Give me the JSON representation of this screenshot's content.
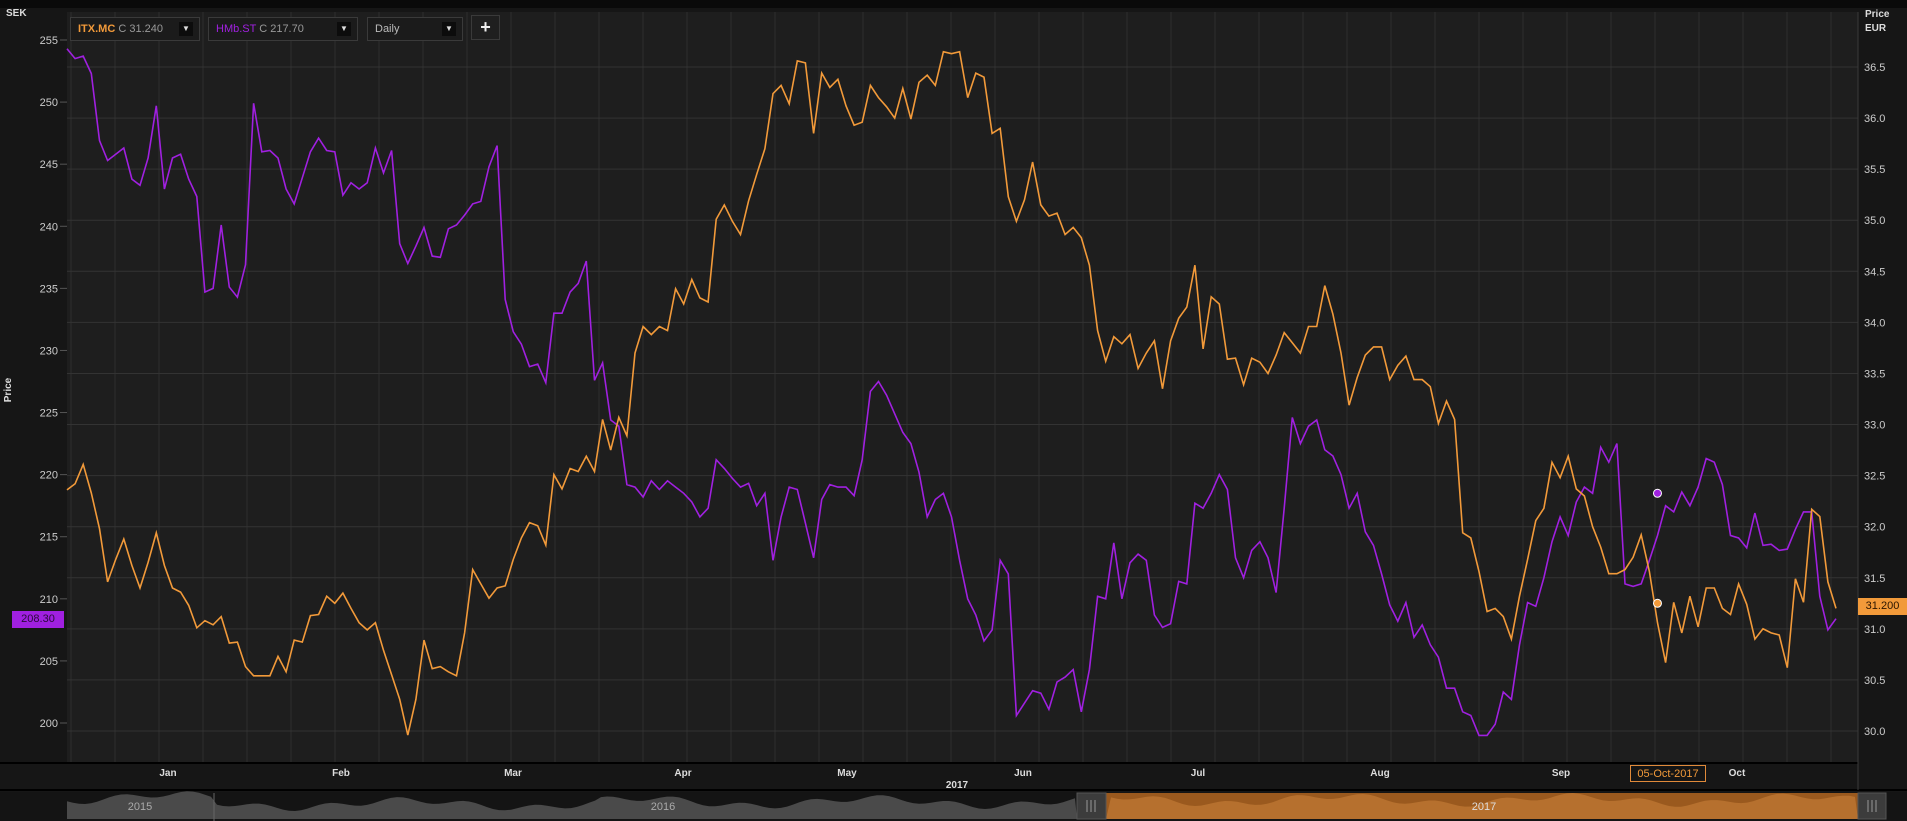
{
  "toolbar": {
    "series1_symbol": "ITX.MC",
    "series1_close": "C 31.240",
    "series2_symbol": "HMb.ST",
    "series2_close": "C 217.70",
    "interval": "Daily",
    "add_label": "+"
  },
  "axes": {
    "left_unit": "SEK",
    "left_title": "Price",
    "right_title": "Price",
    "right_unit": "EUR"
  },
  "last_values": {
    "left": "208.30",
    "right": "31.200"
  },
  "crosshair_date": "05-Oct-2017",
  "navigator": {
    "years": [
      "2015",
      "2016",
      "2017"
    ]
  },
  "colors": {
    "itx": "#f29a3a",
    "hm": "#a020e0",
    "bg": "#1e1e1e",
    "grid": "#333333"
  },
  "chart_data": {
    "type": "line",
    "title": "",
    "xlabel": "2017",
    "x_tick_labels": [
      "Jan",
      "Feb",
      "Mar",
      "Apr",
      "May",
      "Jun",
      "Jul",
      "Aug",
      "Sep",
      "Oct"
    ],
    "left_axis": {
      "label": "Price",
      "unit": "SEK",
      "ylim": [
        199,
        256
      ],
      "ticks": [
        200,
        205,
        210,
        215,
        220,
        225,
        230,
        235,
        240,
        245,
        250,
        255
      ]
    },
    "right_axis": {
      "label": "Price",
      "unit": "EUR",
      "ylim": [
        29.85,
        36.65
      ],
      "ticks": [
        30.0,
        30.5,
        31.0,
        31.5,
        32.0,
        32.5,
        33.0,
        33.5,
        34.0,
        34.5,
        35.0,
        35.5,
        36.0,
        36.5
      ]
    },
    "hover": {
      "date": "05-Oct-2017",
      "index": 196,
      "hm": 218.5,
      "itx": 31.25
    },
    "series": [
      {
        "name": "HMb.ST",
        "axis": "left",
        "color": "#a020e0",
        "values": [
          254.3,
          253.5,
          253.7,
          252.3,
          246.9,
          245.3,
          245.8,
          246.3,
          243.8,
          243.3,
          245.5,
          249.7,
          243,
          245.5,
          245.8,
          243.8,
          242.4,
          234.7,
          235,
          240.1,
          235.1,
          234.3,
          236.9,
          249.9,
          246,
          246.1,
          245.5,
          243,
          241.8,
          243.9,
          246,
          247.1,
          246.1,
          246,
          242.5,
          243.5,
          243,
          243.5,
          246.3,
          244.3,
          246.1,
          238.6,
          237,
          238.4,
          239.9,
          237.6,
          237.5,
          239.8,
          240.1,
          240.9,
          241.8,
          242,
          244.8,
          246.5,
          234.1,
          231.5,
          230.5,
          228.7,
          228.9,
          227.4,
          233,
          233,
          234.7,
          235.4,
          237.2,
          227.6,
          229,
          224.4,
          223.9,
          219.2,
          219,
          218.2,
          219.5,
          218.8,
          219.5,
          219,
          218.5,
          217.8,
          216.6,
          217.3,
          221.2,
          220.5,
          219.7,
          219,
          219.3,
          217.5,
          218.5,
          213.1,
          216.6,
          219,
          218.8,
          216.1,
          213.3,
          218,
          219.2,
          219,
          219,
          218.3,
          221.2,
          226.7,
          227.5,
          226.4,
          224.9,
          223.4,
          222.5,
          220.2,
          216.6,
          218,
          218.5,
          216.6,
          213.1,
          210,
          208.7,
          206.6,
          207.5,
          213.1,
          212,
          200.6,
          201.6,
          202.6,
          202.4,
          201.1,
          203.3,
          203.7,
          204.3,
          200.9,
          204.3,
          210.2,
          210,
          214.5,
          210,
          212.9,
          213.6,
          213.1,
          208.7,
          207.7,
          208,
          211.4,
          211.2,
          217.7,
          217.3,
          218.5,
          220,
          218.8,
          213.3,
          211.7,
          213.9,
          214.6,
          213.3,
          210.5,
          217.3,
          224.6,
          222.5,
          223.9,
          224.4,
          222,
          221.5,
          220,
          217.3,
          218.5,
          215.4,
          214.3,
          212,
          209.5,
          208.2,
          209.7,
          206.9,
          207.9,
          206.3,
          205.3,
          202.8,
          202.8,
          200.9,
          200.6,
          199,
          199,
          199.9,
          202.5,
          201.9,
          206.3,
          209.7,
          209.4,
          211.7,
          214.6,
          216.6,
          215.1,
          217.8,
          219,
          218.5,
          222.2,
          221,
          222.5,
          211.2,
          211,
          211.2,
          213.1,
          215.1,
          217.5,
          217,
          218.6,
          217.5,
          219,
          221.3,
          221,
          219.2,
          215.1,
          214.9,
          214.1,
          216.9,
          214.3,
          214.4,
          213.9,
          214,
          215.6,
          217,
          217,
          210.2,
          207.5,
          208.4
        ]
      },
      {
        "name": "ITX.MC",
        "axis": "right",
        "color": "#f29a3a",
        "values": [
          32.36,
          32.42,
          32.61,
          32.33,
          31.98,
          31.46,
          31.68,
          31.88,
          31.62,
          31.4,
          31.65,
          31.94,
          31.62,
          31.4,
          31.36,
          31.23,
          31.01,
          31.08,
          31.04,
          31.12,
          30.86,
          30.87,
          30.63,
          30.54,
          30.54,
          30.54,
          30.73,
          30.58,
          30.89,
          30.87,
          31.13,
          31.14,
          31.32,
          31.25,
          31.35,
          31.2,
          31.06,
          30.99,
          31.06,
          30.79,
          30.55,
          30.31,
          29.96,
          30.31,
          30.89,
          30.61,
          30.63,
          30.58,
          30.54,
          30.96,
          31.58,
          31.44,
          31.3,
          31.4,
          31.42,
          31.68,
          31.89,
          32.04,
          32.01,
          31.82,
          32.51,
          32.37,
          32.57,
          32.54,
          32.69,
          32.54,
          33.05,
          32.75,
          33.07,
          32.89,
          33.7,
          33.96,
          33.88,
          33.96,
          33.92,
          34.33,
          34.18,
          34.42,
          34.24,
          34.2,
          35.01,
          35.15,
          34.99,
          34.86,
          35.19,
          35.45,
          35.7,
          36.24,
          36.32,
          36.14,
          36.56,
          36.54,
          35.85,
          36.44,
          36.3,
          36.38,
          36.12,
          35.93,
          35.96,
          36.32,
          36.2,
          36.11,
          36.0,
          36.29,
          35.99,
          36.35,
          36.42,
          36.32,
          36.65,
          36.63,
          36.65,
          36.2,
          36.44,
          36.4,
          35.85,
          35.9,
          35.23,
          34.99,
          35.2,
          35.57,
          35.15,
          35.04,
          35.07,
          34.86,
          34.93,
          34.83,
          34.56,
          33.92,
          33.62,
          33.86,
          33.79,
          33.88,
          33.55,
          33.7,
          33.82,
          33.35,
          33.82,
          34.04,
          34.15,
          34.56,
          33.74,
          34.25,
          34.18,
          33.64,
          33.65,
          33.39,
          33.65,
          33.61,
          33.5,
          33.68,
          33.9,
          33.8,
          33.7,
          33.96,
          33.96,
          34.36,
          34.08,
          33.7,
          33.19,
          33.46,
          33.68,
          33.76,
          33.76,
          33.44,
          33.58,
          33.67,
          33.44,
          33.44,
          33.37,
          33.01,
          33.23,
          33.05,
          31.94,
          31.89,
          31.56,
          31.17,
          31.2,
          31.12,
          30.9,
          31.32,
          31.68,
          32.06,
          32.18,
          32.63,
          32.48,
          32.69,
          32.37,
          32.3,
          32.0,
          31.8,
          31.54,
          31.54,
          31.58,
          31.7,
          31.92,
          31.56,
          31.06,
          30.67,
          31.26,
          30.96,
          31.32,
          31.02,
          31.4,
          31.4,
          31.2,
          31.14,
          31.44,
          31.24,
          30.9,
          31.0,
          30.96,
          30.94,
          30.62,
          31.49,
          31.26,
          32.17,
          32.1,
          31.46,
          31.2
        ]
      }
    ]
  }
}
